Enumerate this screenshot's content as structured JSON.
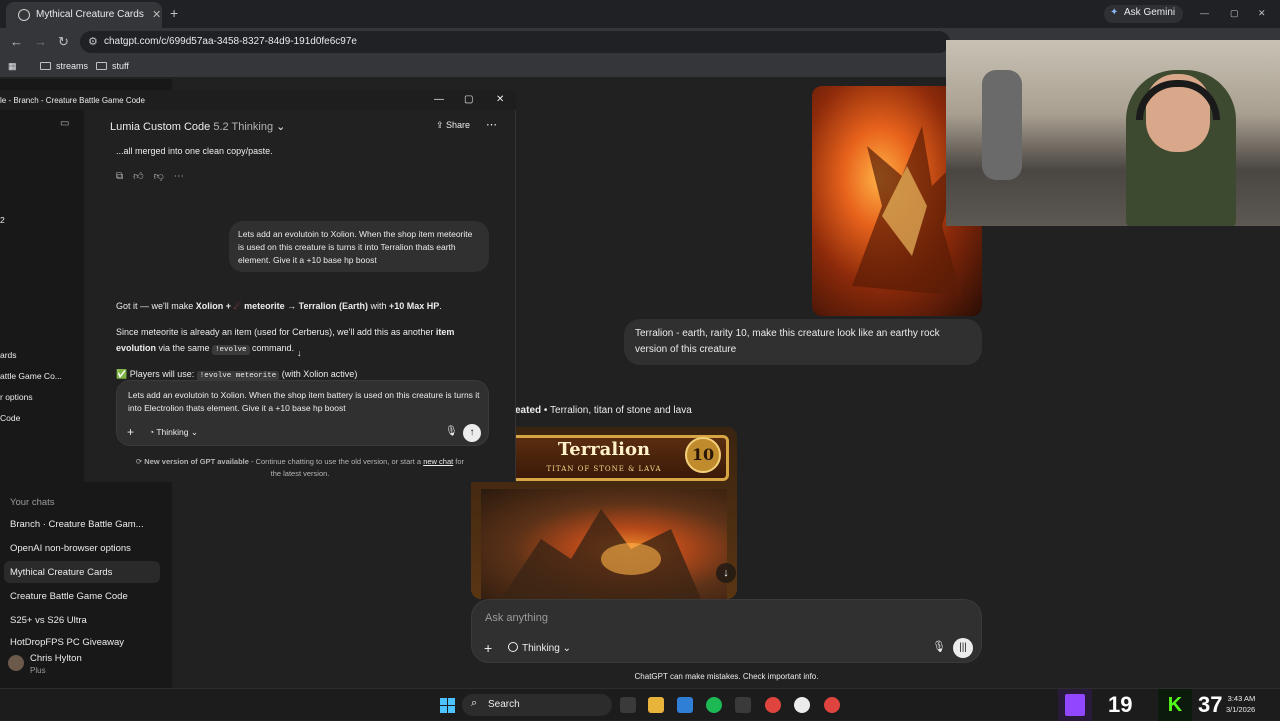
{
  "browser": {
    "tab_title": "Mythical Creature Cards",
    "new_tab": "+",
    "gemini_label": "Ask Gemini",
    "url": "chatgpt.com/c/699d57aa-3458-8327-84d9-191d0fe6c97e",
    "bookmarks": [
      "streams",
      "stuff"
    ]
  },
  "sidebar": {
    "fragments": [
      "2",
      "ards",
      "attle Game Co...",
      "r options",
      "Code"
    ],
    "your_chats_label": "Your chats",
    "chats": [
      "Branch · Creature Battle Gam...",
      "OpenAI non-browser options",
      "Mythical Creature Cards",
      "Creature Battle Game Code",
      "S25+ vs S26 Ultra",
      "HotDropFPS PC Giveaway"
    ],
    "user_name": "Chris Hylton",
    "user_plan": "Plus"
  },
  "main": {
    "user_message": "Terralion - earth, rarity 10, make this creature look like an earthy rock version of this creature",
    "created_prefix": "eated",
    "created_caption": " • Terralion, titan of stone and lava",
    "card": {
      "title": "Terralion",
      "subtitle": "TITAN OF STONE & LAVA",
      "rarity": "10"
    },
    "composer_placeholder": "Ask anything",
    "thinking_label": "Thinking",
    "disclaimer": "ChatGPT can make mistakes. Check important info."
  },
  "overlay": {
    "window_title": "le - Branch - Creature Battle Game Code",
    "model_name": "Lumia Custom Code",
    "model_version": "5.2 Thinking",
    "share_label": "Share",
    "line_merged": "...all merged into one clean copy/paste.",
    "user_message": "Lets add an evolutoin to Xolion. When the shop item meteorite is used on this creature is turns it into Terralion thats earth element. Give it a +10 base hp boost",
    "reply_intro_a": "Got it — we'll make ",
    "reply_intro_b": "Xolion + ",
    "reply_intro_c": " meteorite → Terralion (Earth)",
    "reply_intro_d": " with ",
    "reply_intro_e": "+10 Max HP",
    "reply_intro_f": ".",
    "reply_p2_a": "Since meteorite is already an item (used for Cerberus), we'll add this as another ",
    "reply_p2_b": "item",
    "reply_p2_c": "evolution",
    "reply_p2_d": " via the same ",
    "reply_p2_code": "!evolve",
    "reply_p2_e": " command.",
    "players_label": "Players will use: ",
    "players_code": "!evolve meteorite",
    "players_suffix": " (with Xolion active)",
    "draft": "Lets add an evolutoin to Xolion. When the shop item battery is used on this creature is turns it into Electrolion thats  element. Give it a +10 base hp boost",
    "thinking_label": "Thinking",
    "notice_a": "New version of GPT available",
    "notice_b": " - Continue chatting to use the old version, or start a ",
    "notice_link": "new chat",
    "notice_c": " for the latest version."
  },
  "taskbar": {
    "search_label": "Search",
    "twitch_viewers": "19",
    "kick_viewers": "37",
    "time": "3:43 AM",
    "date": "3/1/2026"
  },
  "colors": {
    "background": "#212121",
    "sidebar": "#181818",
    "bubble": "#303030",
    "twitch": "#9146ff",
    "kick": "#53fc18",
    "misspelling_underline": "#e0443e"
  },
  "icons": [
    "chatgpt-favicon",
    "close-icon",
    "plus-icon",
    "back-icon",
    "forward-icon",
    "reload-icon",
    "tune-icon",
    "apps-icon",
    "folder-icon",
    "copy-icon",
    "thumbs-up-icon",
    "thumbs-down-icon",
    "more-icon",
    "share-icon",
    "mic-icon",
    "voice-icon",
    "send-icon",
    "download-icon",
    "windows-icon",
    "search-icon",
    "twitch-icon",
    "kick-icon"
  ]
}
